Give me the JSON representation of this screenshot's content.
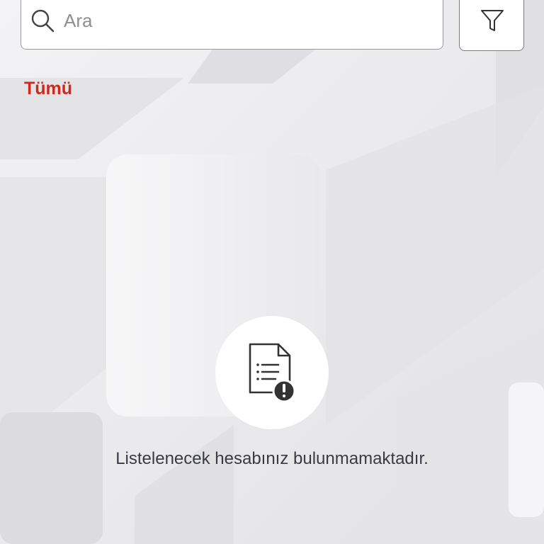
{
  "search": {
    "placeholder": "Ara",
    "value": "",
    "icon": "search-icon"
  },
  "filter": {
    "icon": "filter-icon"
  },
  "tabs": [
    {
      "label": "Tümü",
      "active": true
    }
  ],
  "empty_state": {
    "icon": "document-alert-icon",
    "message": "Listelenecek hesabınız bulunmamaktadır."
  },
  "colors": {
    "accent": "#d0281e",
    "text": "#3a3a44",
    "placeholder": "#8e8e93",
    "background": "#ececee"
  }
}
